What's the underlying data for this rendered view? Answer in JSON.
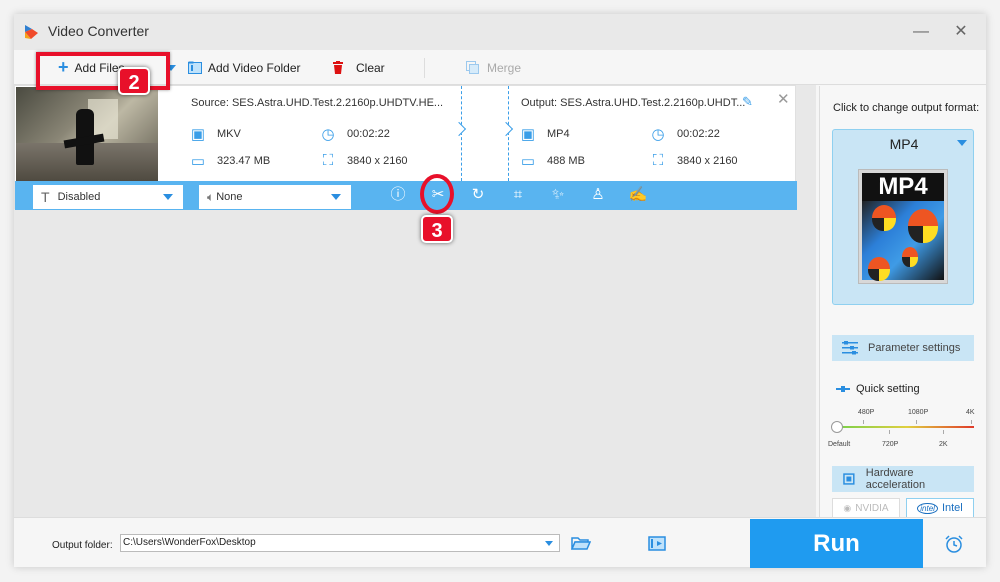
{
  "window": {
    "title": "Video Converter",
    "minimize_glyph": "—",
    "close_glyph": "✕"
  },
  "toolbar": {
    "add_files": "Add Files",
    "add_video_folder": "Add Video Folder",
    "clear": "Clear",
    "merge": "Merge"
  },
  "file": {
    "source_title": "Source: SES.Astra.UHD.Test.2.2160p.UHDTV.HE...",
    "source": {
      "format": "MKV",
      "duration": "00:02:22",
      "size": "323.47 MB",
      "resolution": "3840 x 2160"
    },
    "output_title": "Output: SES.Astra.UHD.Test.2.2160p.UHDT...",
    "output": {
      "format": "MP4",
      "duration": "00:02:22",
      "size": "488 MB",
      "resolution": "3840 x 2160"
    },
    "subtitle_select": "Disabled",
    "audio_select": "None",
    "tools": [
      "info-icon",
      "trim-icon",
      "rotate-icon",
      "crop-icon",
      "effects-icon",
      "watermark-icon",
      "subtitle-edit-icon"
    ]
  },
  "annotations": {
    "badge_add_files": "2",
    "badge_trim": "3"
  },
  "right_panel": {
    "label": "Click to change output format:",
    "format": "MP4",
    "format_art_text": "MP4",
    "parameter_settings": "Parameter settings",
    "quick_setting": "Quick setting",
    "quality_ticks_top": [
      "480P",
      "1080P",
      "4K"
    ],
    "quality_ticks_bottom": [
      "Default",
      "720P",
      "2K"
    ],
    "quality_selected": "Default",
    "hardware_acceleration": "Hardware acceleration",
    "gpu_nvidia": "NVIDIA",
    "gpu_intel": "Intel",
    "intel_logo_text": "intel"
  },
  "bottom": {
    "output_folder_label": "Output folder:",
    "output_folder_value": "C:\\Users\\WonderFox\\Desktop",
    "run": "Run"
  },
  "colors": {
    "accent": "#1f9bf0",
    "edit_bar": "#59b4f0",
    "annotation_red": "#e8102a",
    "panel_highlight": "#c9e5f5"
  }
}
